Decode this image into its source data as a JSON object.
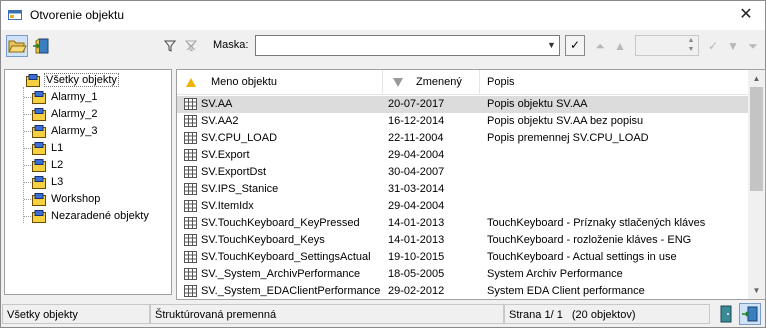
{
  "window": {
    "title": "Otvorenie objektu",
    "close_glyph": "✕"
  },
  "toolbar": {
    "open_icon": "folder-open-icon",
    "exit_icon": "exit-door-icon",
    "filter_icon": "filter-icon",
    "filter_clear_icon": "filter-clear-icon",
    "maska_label": "Maska:",
    "maska_value": "",
    "confirm_glyph": "✓"
  },
  "tree": {
    "items": [
      {
        "label": "Všetky objekty"
      },
      {
        "label": "Alarmy_1"
      },
      {
        "label": "Alarmy_2"
      },
      {
        "label": "Alarmy_3"
      },
      {
        "label": "L1"
      },
      {
        "label": "L2"
      },
      {
        "label": "L3"
      },
      {
        "label": "Workshop"
      },
      {
        "label": "Nezaradené objekty"
      }
    ]
  },
  "list": {
    "columns": {
      "name": "Meno objektu",
      "changed": "Zmenený",
      "desc": "Popis"
    },
    "rows": [
      {
        "name": "SV.AA",
        "changed": "20-07-2017",
        "desc": "Popis objektu SV.AA"
      },
      {
        "name": "SV.AA2",
        "changed": "16-12-2014",
        "desc": "Popis objektu SV.AA bez popisu"
      },
      {
        "name": "SV.CPU_LOAD",
        "changed": "22-11-2004",
        "desc": "Popis premennej SV.CPU_LOAD"
      },
      {
        "name": "SV.Export",
        "changed": "29-04-2004",
        "desc": ""
      },
      {
        "name": "SV.ExportDst",
        "changed": "30-04-2007",
        "desc": ""
      },
      {
        "name": "SV.IPS_Stanice",
        "changed": "31-03-2014",
        "desc": ""
      },
      {
        "name": "SV.ItemIdx",
        "changed": "29-04-2004",
        "desc": ""
      },
      {
        "name": "SV.TouchKeyboard_KeyPressed",
        "changed": "14-01-2013",
        "desc": "TouchKeyboard - Príznaky stlačených kláves"
      },
      {
        "name": "SV.TouchKeyboard_Keys",
        "changed": "14-01-2013",
        "desc": "TouchKeyboard - rozloženie kláves - ENG"
      },
      {
        "name": "SV.TouchKeyboard_SettingsActual",
        "changed": "19-10-2015",
        "desc": "TouchKeyboard - Actual settings in use"
      },
      {
        "name": "SV._System_ArchivPerformance",
        "changed": "18-05-2005",
        "desc": "System Archiv Performance"
      },
      {
        "name": "SV._System_EDAClientPerformance",
        "changed": "29-02-2012",
        "desc": "System EDA Client performance"
      }
    ]
  },
  "status": {
    "filter": "Všetky objekty",
    "type": "Štruktúrovaná premenná",
    "page": "Strana  1/ 1",
    "count": "(20 objektov)"
  }
}
